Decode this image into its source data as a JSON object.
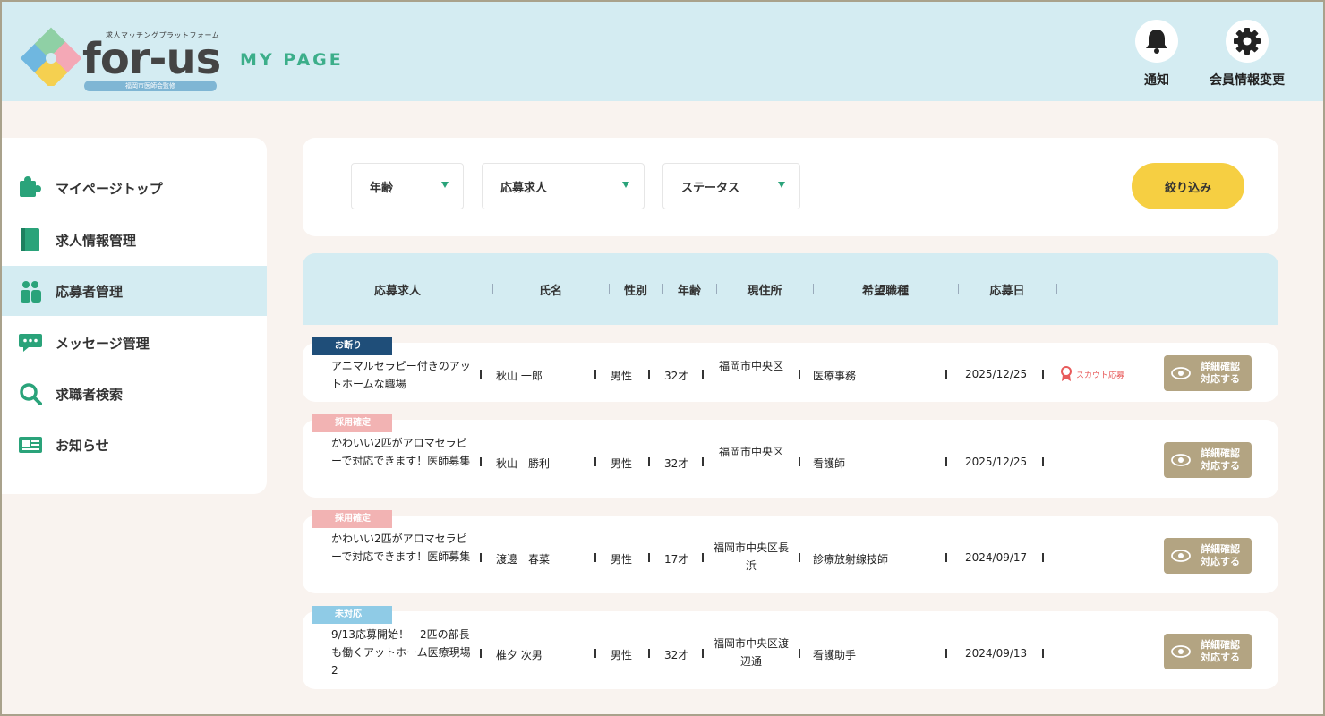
{
  "header": {
    "logo_tagline": "求人マッチングプラットフォーム",
    "logo_text": "for-us",
    "logo_pill": "福岡市医師会監修",
    "mypage": "MY PAGE",
    "notification_label": "通知",
    "member_settings_label": "会員情報変更"
  },
  "sidebar": {
    "items": [
      {
        "label": "マイページトップ",
        "icon": "puzzle-icon"
      },
      {
        "label": "求人情報管理",
        "icon": "notebook-icon"
      },
      {
        "label": "応募者管理",
        "icon": "users-icon"
      },
      {
        "label": "メッセージ管理",
        "icon": "chat-icon"
      },
      {
        "label": "求職者検索",
        "icon": "search-icon"
      },
      {
        "label": "お知らせ",
        "icon": "news-icon"
      }
    ],
    "active_index": 2
  },
  "filters": {
    "age": "年齢",
    "job_applied": "応募求人",
    "status": "ステータス",
    "submit_label": "絞り込み"
  },
  "table": {
    "columns": [
      "応募求人",
      "氏名",
      "性別",
      "年齢",
      "現住所",
      "希望職種",
      "応募日"
    ],
    "rows": [
      {
        "badge": "お断り",
        "badge_color": "#1f4e79",
        "job": "アニマルセラピー付きのアットホームな職場",
        "name": "秋山 一郎",
        "gender": "男性",
        "age": "32才",
        "address": "福岡市中央区",
        "desired_job": "医療事務",
        "date": "2025/12/25",
        "scout": "スカウト応募",
        "detail_label": "詳細確認 対応する"
      },
      {
        "badge": "採用確定",
        "badge_color": "#f2b3b3",
        "job": "かわいい2匹がアロマセラピーで対応できます！医師募集",
        "name": "秋山　勝利",
        "gender": "男性",
        "age": "32才",
        "address": "福岡市中央区",
        "desired_job": "看護師",
        "date": "2025/12/25",
        "scout": "",
        "detail_label": "詳細確認 対応する"
      },
      {
        "badge": "採用確定",
        "badge_color": "#f2b3b3",
        "job": "かわいい2匹がアロマセラピーで対応できます！医師募集",
        "name": "渡邊　春菜",
        "gender": "男性",
        "age": "17才",
        "address": "福岡市中央区長浜",
        "desired_job": "診療放射線技師",
        "date": "2024/09/17",
        "scout": "",
        "detail_label": "詳細確認 対応する"
      },
      {
        "badge": "未対応",
        "badge_color": "#8fcbe6",
        "job": "9/13応募開始！　2匹の部長も働くアットホーム医療現場　2",
        "name": "椎夕 次男",
        "gender": "男性",
        "age": "32才",
        "address": "福岡市中央区渡辺通",
        "desired_job": "看護助手",
        "date": "2024/09/13",
        "scout": "",
        "detail_label": "詳細確認 対応する"
      }
    ]
  },
  "colors": {
    "header_bg": "#d4ecf2",
    "accent_green": "#2aa37a",
    "filter_button": "#f6cf42",
    "detail_button": "#b3a482"
  }
}
